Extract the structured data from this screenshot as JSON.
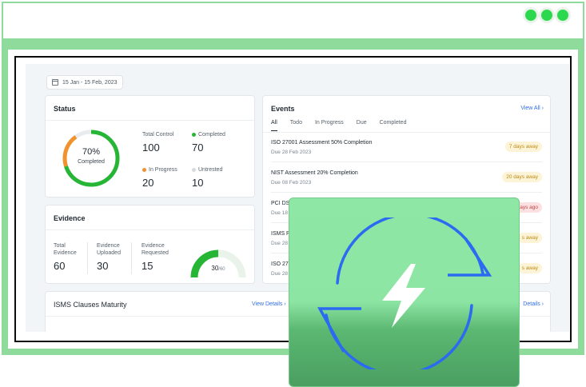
{
  "window": {
    "controls": [
      "dot",
      "dot",
      "dot"
    ]
  },
  "date_range": {
    "label": "15 Jan - 15 Feb, 2023",
    "icon": "calendar-icon"
  },
  "status": {
    "title": "Status",
    "percent_label": "70%",
    "completed_caption": "Completed",
    "completed_fraction": 0.7,
    "in_progress_fraction": 0.2,
    "stats": [
      {
        "label": "Total Control",
        "value": "100"
      },
      {
        "label": "Completed",
        "value": "70",
        "dot_color": "#27b536"
      },
      {
        "label": "In Progress",
        "value": "20",
        "dot_color": "#f0932f"
      },
      {
        "label": "Untrested",
        "value": "10",
        "dot_color": "#d7dbdf"
      }
    ]
  },
  "evidence": {
    "title": "Evidence",
    "stats": [
      {
        "label_line1": "Total",
        "label_line2": "Evidence",
        "value": "60"
      },
      {
        "label_line1": "Evidence",
        "label_line2": "Uploaded",
        "value": "30"
      },
      {
        "label_line1": "Evidence",
        "label_line2": "Requested",
        "value": "15"
      }
    ],
    "gauge_value": "30",
    "gauge_total": "/60",
    "gauge_fraction": 0.5
  },
  "events": {
    "title": "Events",
    "view_all": "View All",
    "tabs": [
      "All",
      "Todo",
      "In Progress",
      "Due",
      "Completed"
    ],
    "items": [
      {
        "title": "ISO 27001 Assessment 50% Completion",
        "due": "Due 28 Feb 2023",
        "badge": "7 days away",
        "kind": "warn"
      },
      {
        "title": "NIST Assessment 20% Completion",
        "due": "Due 08 Feb 2023",
        "badge": "20 days away",
        "kind": "warn"
      },
      {
        "title": "PCI DSS",
        "due": "Due 18 F",
        "badge": "days ago",
        "kind": "late"
      },
      {
        "title": "ISMS Po",
        "due": "Due 28 F",
        "badge": "s away",
        "kind": "warn"
      },
      {
        "title": "ISO 270",
        "due": "Due 28 F",
        "badge": "s away",
        "kind": "warn"
      }
    ]
  },
  "isms": {
    "title": "ISMS Clauses Maturity",
    "view_details": "View Details",
    "view_details_right": "Details"
  },
  "colors": {
    "frame": "#8fdb9c",
    "accent_green": "#27b536",
    "link_blue": "#2f6fe4",
    "sync_blue": "#2b6bf2"
  },
  "overlay": {
    "icon": "sync-icon",
    "inner_icon": "lightning-icon"
  }
}
